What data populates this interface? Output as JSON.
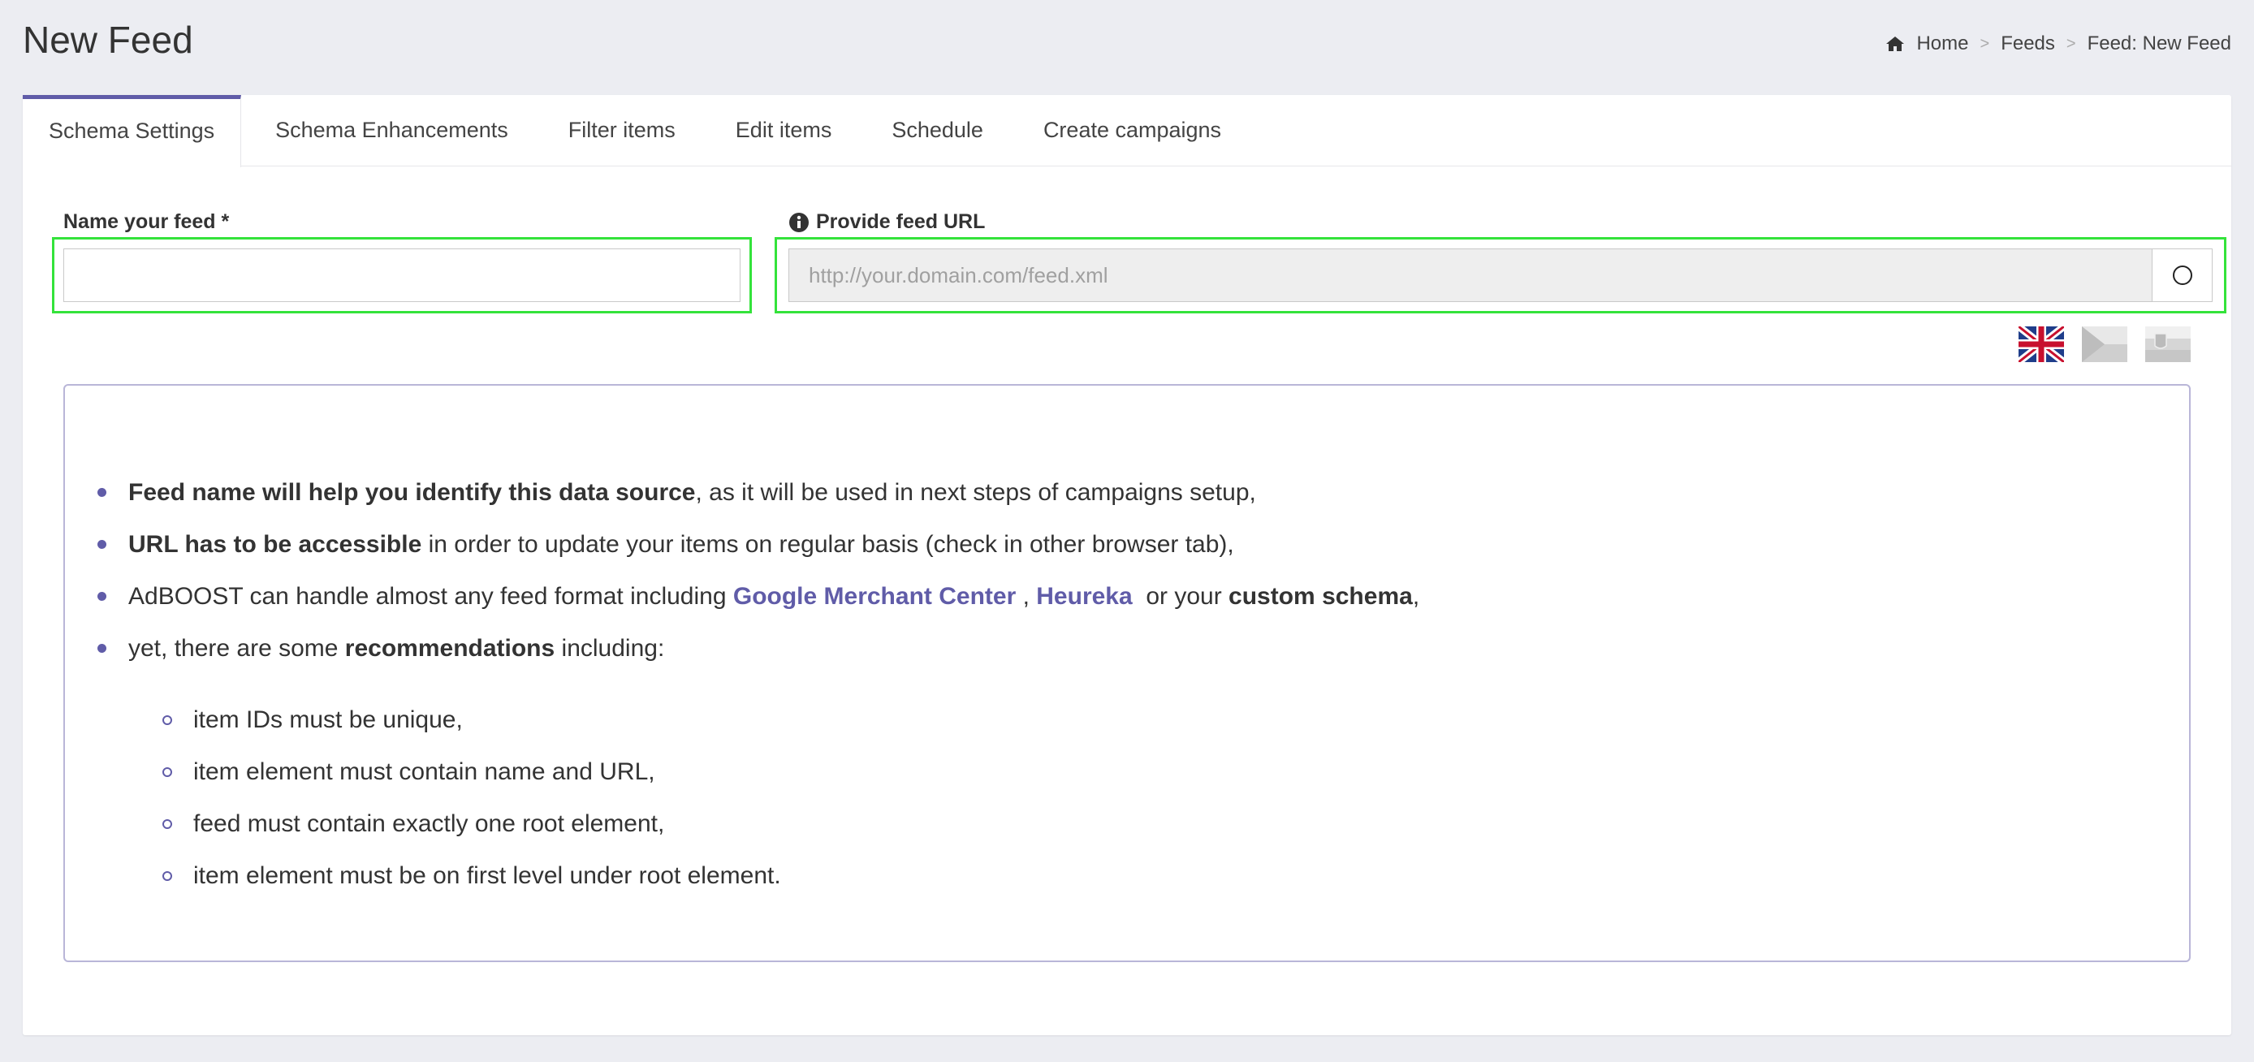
{
  "page": {
    "title": "New Feed"
  },
  "breadcrumb": {
    "home": "Home",
    "feeds": "Feeds",
    "current": "Feed: New Feed",
    "separator": ">"
  },
  "tabs": [
    {
      "label": "Schema Settings",
      "active": true
    },
    {
      "label": "Schema Enhancements"
    },
    {
      "label": "Filter items"
    },
    {
      "label": "Edit items"
    },
    {
      "label": "Schedule"
    },
    {
      "label": "Create campaigns"
    }
  ],
  "form": {
    "name_label": "Name your feed *",
    "name_value": "",
    "url_label": "Provide feed URL",
    "url_value": "",
    "url_placeholder": "http://your.domain.com/feed.xml"
  },
  "languages": [
    "English",
    "Czech",
    "Slovak"
  ],
  "info": {
    "item1_bold": "Feed name will help you identify this data source",
    "item1_rest": ", as it will be used in next steps of campaigns setup,",
    "item2_bold": "URL has to be accessible",
    "item2_rest": " in order to update your items on regular basis (check in other browser tab),",
    "item3_pre": "AdBOOST can handle almost any feed format including ",
    "item3_link1": "Google Merchant Center",
    "item3_comma": " , ",
    "item3_link2": "Heureka",
    "item3_mid": "  or your ",
    "item3_bold": "custom schema",
    "item3_end": ",",
    "item4_pre": "yet, there are some ",
    "item4_bold": "recommendations",
    "item4_rest": " including:",
    "sub": [
      "item IDs must be unique,",
      "item element must contain name and URL,",
      "feed must contain exactly one root element,",
      "item element must be on first level under root element."
    ]
  },
  "colors": {
    "accent": "#605ca8",
    "highlight": "#34e33b",
    "background": "#ecedf2"
  }
}
